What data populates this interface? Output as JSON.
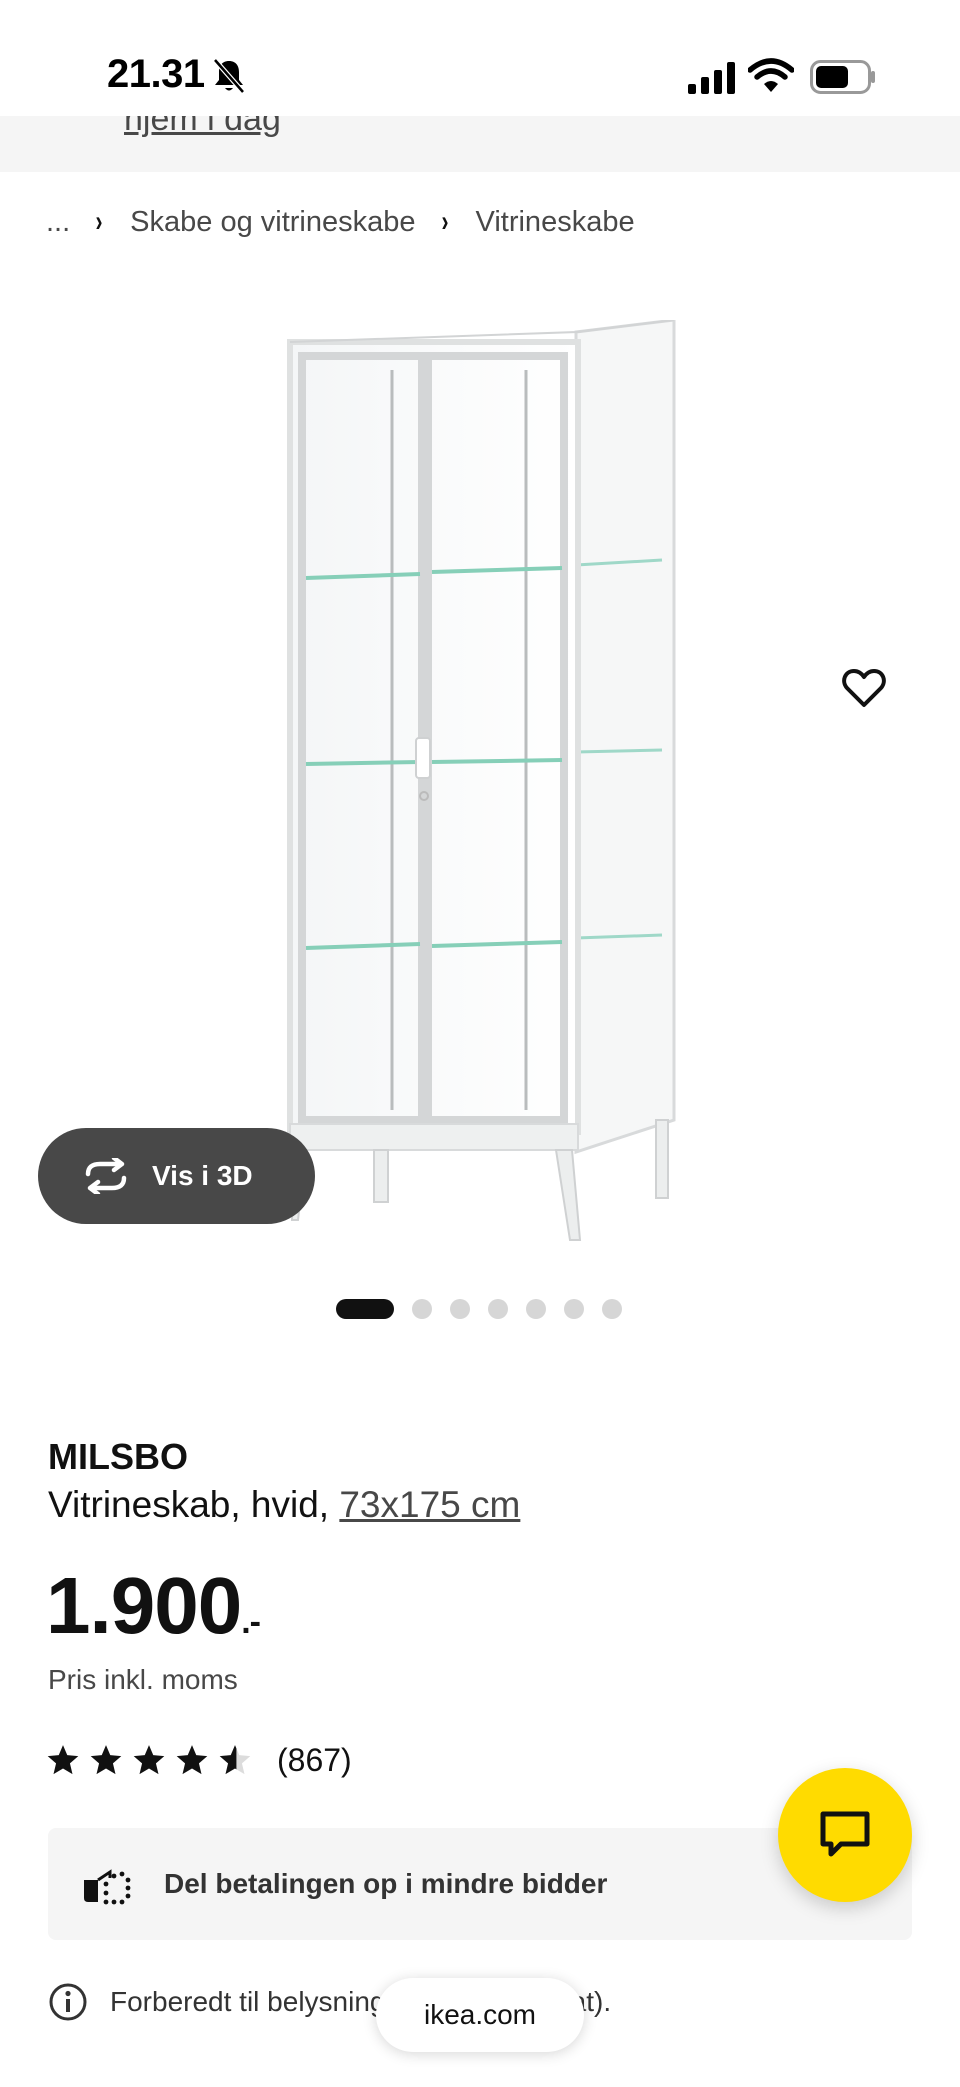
{
  "status_bar": {
    "time": "21.31",
    "icons": [
      "bell-muted-icon",
      "signal-icon",
      "wifi-icon",
      "battery-icon"
    ]
  },
  "top_banner": {
    "link": "hjem i dag"
  },
  "breadcrumb": {
    "ellipsis": "...",
    "items": [
      "Skabe og vitrineskabe",
      "Vitrineskabe"
    ]
  },
  "gallery": {
    "view_3d_label": "Vis i 3D",
    "dot_count": 7,
    "active_dot": 1
  },
  "product": {
    "name": "MILSBO",
    "description": "Vitrineskab, hvid, ",
    "size": "73x175 cm",
    "price": "1.900",
    "price_suffix": ".-",
    "price_note": "Pris inkl. moms",
    "rating": 4.5,
    "review_count": "(867)"
  },
  "installment": {
    "label": "Del betalingen op i mindre bidder"
  },
  "info": {
    "text": "Forberedt til belysning (sælges separat)."
  },
  "url_bar": {
    "domain": "ikea.com"
  },
  "colors": {
    "chat_accent": "#ffdb00",
    "view3d_bg": "#484848",
    "banner_bg": "#f5f5f5"
  }
}
